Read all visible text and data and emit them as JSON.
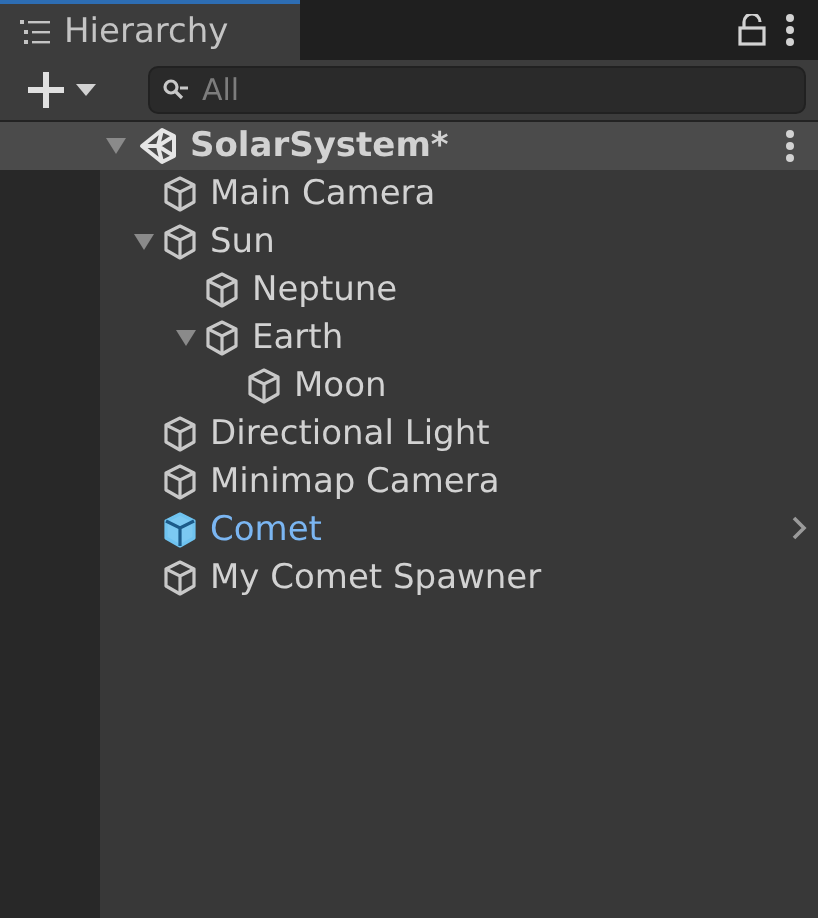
{
  "tab": {
    "label": "Hierarchy",
    "selected": true
  },
  "search": {
    "placeholder": "All"
  },
  "scene": {
    "name": "SolarSystem*",
    "expanded": true,
    "children": [
      {
        "name": "Main Camera",
        "kind": "object"
      },
      {
        "name": "Sun",
        "kind": "object",
        "expanded": true,
        "children": [
          {
            "name": "Neptune",
            "kind": "object"
          },
          {
            "name": "Earth",
            "kind": "object",
            "expanded": true,
            "children": [
              {
                "name": "Moon",
                "kind": "object"
              }
            ]
          }
        ]
      },
      {
        "name": "Directional Light",
        "kind": "object"
      },
      {
        "name": "Minimap Camera",
        "kind": "object"
      },
      {
        "name": "Comet",
        "kind": "prefab"
      },
      {
        "name": "My Comet Spawner",
        "kind": "object"
      }
    ]
  }
}
